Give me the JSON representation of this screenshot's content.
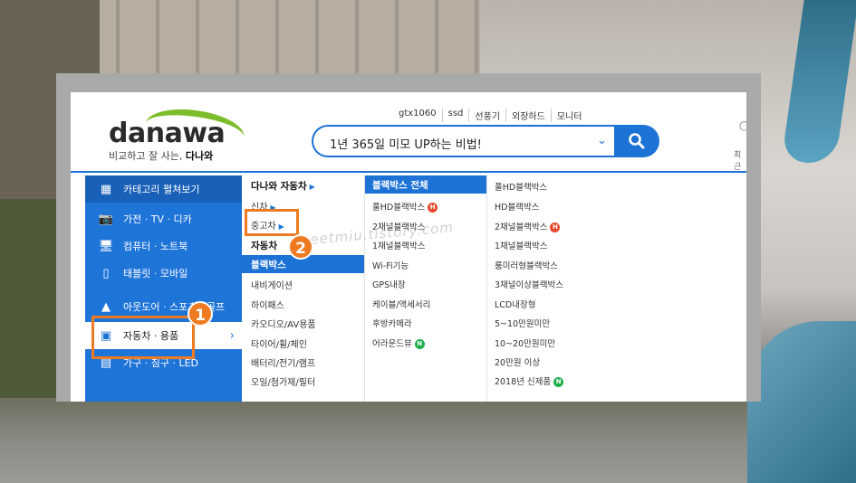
{
  "header": {
    "logo": "danawa",
    "tagline_prefix": "비교하고 잘 사는,",
    "tagline_bold": "다나와",
    "popular_keywords": [
      "gtx1060",
      "ssd",
      "선풍기",
      "외장하드",
      "모니터"
    ],
    "search_value": "1년 365일 미모 UP하는 비법!",
    "right_clip": "최근"
  },
  "categories": [
    {
      "label": "카테고리 펼쳐보기",
      "icon": "grid-icon"
    },
    {
      "label": "가전 · TV · 디카",
      "icon": "camera-icon"
    },
    {
      "label": "컴퓨터 · 노트북",
      "icon": "monitor-icon"
    },
    {
      "label": "태블릿 · 모바일",
      "icon": "phone-icon"
    },
    {
      "label": "아웃도어 · 스포츠 · 골프",
      "icon": "tent-icon"
    },
    {
      "label": "자동차 · 용품",
      "icon": "car-icon"
    },
    {
      "label": "가구 · 침구 · LED",
      "icon": "sofa-icon"
    }
  ],
  "col2": {
    "title": "다나와 자동차",
    "items": [
      "신차",
      "중고차",
      "자동차",
      "블랙박스",
      "내비게이션",
      "하이패스",
      "카오디오/AV용품",
      "타이어/휠/체인",
      "배터리/전기/램프",
      "오일/첨가제/필터"
    ]
  },
  "col3": {
    "head": "블랙박스 전체",
    "items": [
      "풀HD블랙박스",
      "2채널블랙박스",
      "1채널블랙박스",
      "Wi-Fi기능",
      "GPS내장",
      "케이블/액세서리",
      "후방카메라",
      "어라운드뷰"
    ]
  },
  "col4": {
    "items": [
      "풀HD블랙박스",
      "HD블랙박스",
      "2채널블랙박스",
      "1채널블랙박스",
      "룸미러형블랙박스",
      "3채널이상블랙박스",
      "LCD내장형",
      "5~10만원미만",
      "10~20만원미만",
      "20만원 이상",
      "2018년 신제품"
    ]
  },
  "badges": {
    "hot": "H",
    "new": "N"
  },
  "annotations": {
    "step1": "1",
    "step2": "2"
  },
  "watermark": "sweetmiu.tistory.com",
  "colors": {
    "brand_blue": "#1d72d6",
    "brand_green": "#7bbd2a",
    "annotation_orange": "#ee7b22"
  }
}
